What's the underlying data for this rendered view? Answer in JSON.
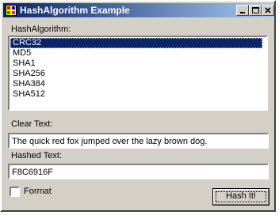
{
  "window": {
    "title": "HashAlgorithm Example"
  },
  "caption_buttons": [
    "minimize",
    "maximize",
    "close"
  ],
  "hash_algorithm": {
    "label": "HashAlgorithm:",
    "items": [
      "CRC32",
      "MD5",
      "SHA1",
      "SHA256",
      "SHA384",
      "SHA512"
    ],
    "selected": "CRC32"
  },
  "clear_text": {
    "label": "Clear Text:",
    "value": "The quick red fox jumped over the lazy brown dog."
  },
  "hashed_text": {
    "label": "Hashed Text:",
    "value": "F8C6916F"
  },
  "format": {
    "label": "Format",
    "checked": false
  },
  "hash_button": {
    "label": "Hash It!"
  },
  "colors": {
    "titlebar_start": "#0a246a",
    "titlebar_end": "#a6caf0",
    "face": "#d4d0c8",
    "selection": "#0a246a"
  }
}
